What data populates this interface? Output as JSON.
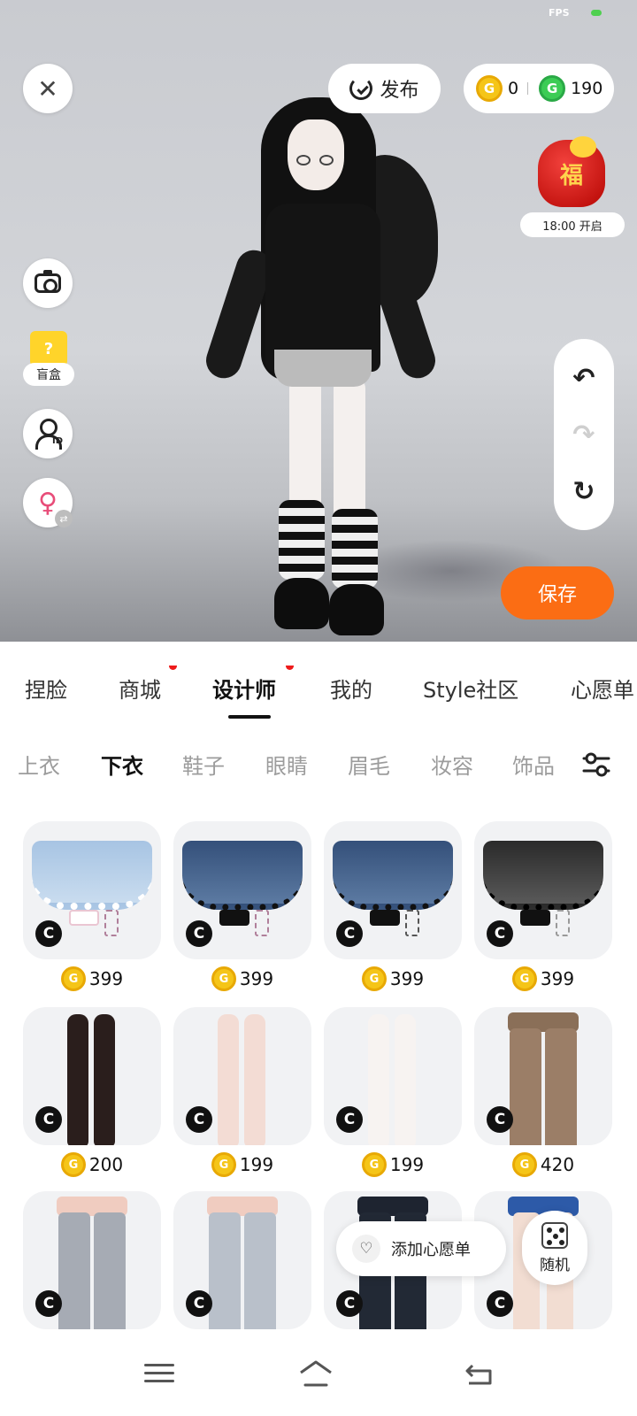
{
  "status": {
    "fps_label": "FPS"
  },
  "toolbar": {
    "close_icon": "close-icon",
    "publish_label": "发布",
    "gold_coins": "0",
    "green_coins": "190",
    "coin_glyph": "G"
  },
  "event": {
    "time_label": "18:00 开启",
    "bag_text": "福"
  },
  "left_tools": {
    "blindbox_label": "盲盒",
    "id_tag": "ID"
  },
  "right_tools": {
    "undo": "↶",
    "redo": "↷",
    "reset": "↻"
  },
  "save_label": "保存",
  "main_tabs": [
    {
      "label": "捏脸",
      "active": false,
      "dot": false
    },
    {
      "label": "商城",
      "active": false,
      "dot": true
    },
    {
      "label": "设计师",
      "active": true,
      "dot": true
    },
    {
      "label": "我的",
      "active": false,
      "dot": false
    },
    {
      "label": "Style社区",
      "active": false,
      "dot": false
    },
    {
      "label": "心愿单",
      "active": false,
      "dot": false
    }
  ],
  "sub_tabs": [
    {
      "label": "上衣",
      "active": false
    },
    {
      "label": "下衣",
      "active": true
    },
    {
      "label": "鞋子",
      "active": false
    },
    {
      "label": "眼睛",
      "active": false
    },
    {
      "label": "眉毛",
      "active": false
    },
    {
      "label": "妆容",
      "active": false
    },
    {
      "label": "饰品",
      "active": false
    }
  ],
  "items": [
    {
      "type": "skirt-light",
      "price": "399"
    },
    {
      "type": "skirt-blue",
      "price": "399"
    },
    {
      "type": "skirt-blue",
      "price": "399"
    },
    {
      "type": "skirt-black",
      "price": "399"
    },
    {
      "type": "tights-black",
      "price": "200"
    },
    {
      "type": "stockings-pink",
      "price": "199"
    },
    {
      "type": "stockings-white",
      "price": "199"
    },
    {
      "type": "pants-brown",
      "price": "420"
    },
    {
      "type": "pants-grey",
      "price": ""
    },
    {
      "type": "pants-lightgrey",
      "price": ""
    },
    {
      "type": "pants-black",
      "price": ""
    },
    {
      "type": "pants-blue",
      "price": ""
    }
  ],
  "creator_badge": "C",
  "wishlist_button": {
    "label": "添加心愿单",
    "icon": "heart-icon"
  },
  "random_button": {
    "label": "随机",
    "icon": "dice-icon"
  },
  "colors": {
    "accent": "#fb6d14",
    "gold": "#f5c518",
    "green": "#3ccc55",
    "dot": "#ee1b1b"
  }
}
